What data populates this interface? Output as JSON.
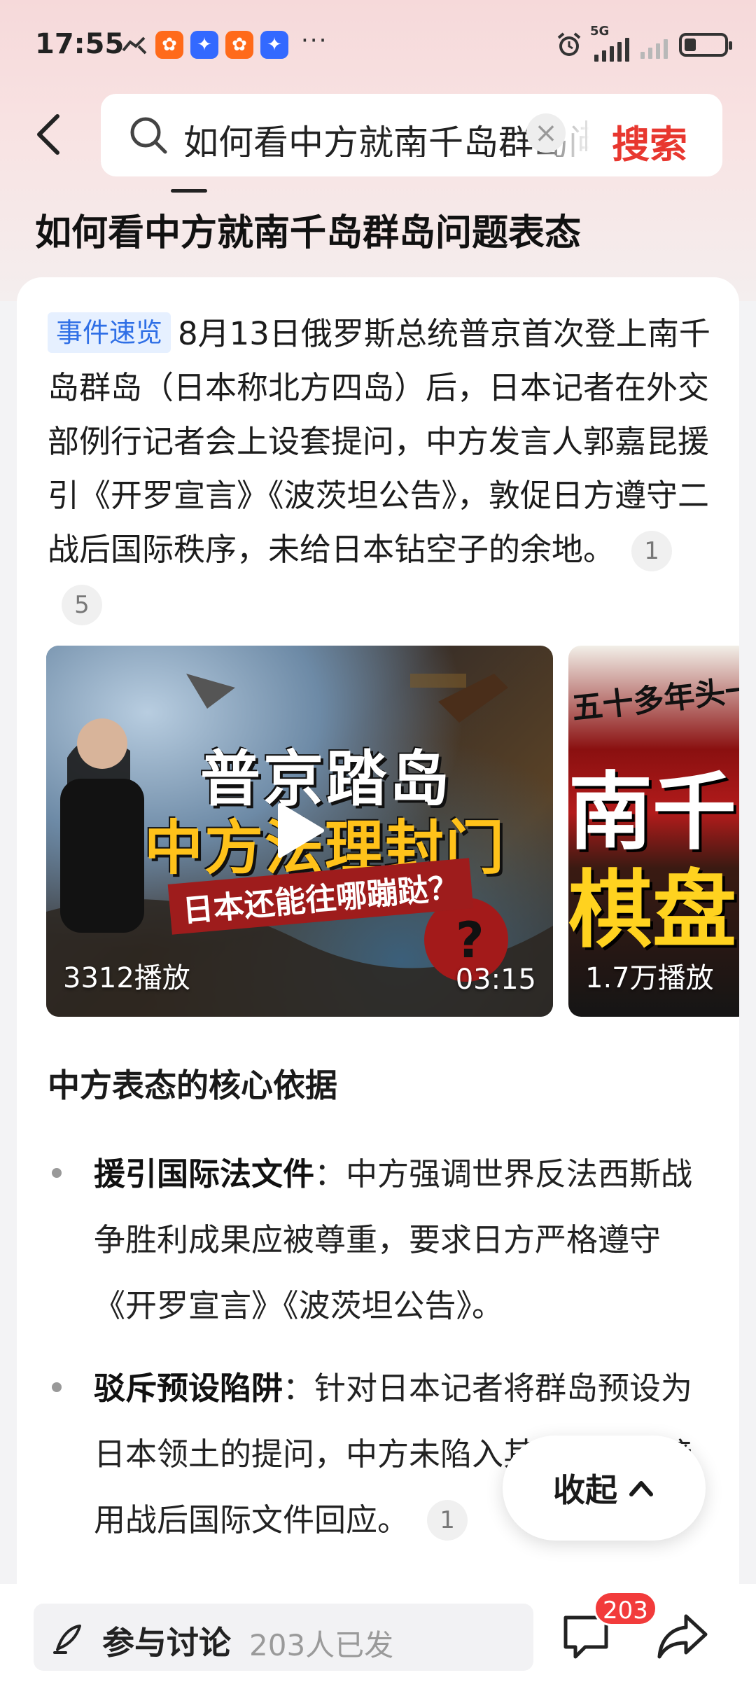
{
  "status_bar": {
    "time": "17:55",
    "app_icons": [
      "app-icon-orange",
      "app-icon-blue",
      "app-icon-orange",
      "app-icon-blue"
    ],
    "more": "···",
    "network": "5G",
    "battery_level": 0.3
  },
  "search": {
    "query": "如何看中方就南千岛群岛问题表态",
    "clear": "×",
    "button": "搜索"
  },
  "page": {
    "title": "如何看中方就南千岛群岛问题表态"
  },
  "summary": {
    "tag": "事件速览",
    "text": "8月13日俄罗斯总统普京首次登上南千岛群岛（日本称北方四岛）后，日本记者在外交部例行记者会上设套提问，中方发言人郭嘉昆援引《开罗宣言》《波茨坦公告》，敦促日方遵守二战后国际秩序，未给日本钻空子的余地。",
    "citations": [
      "1",
      "5"
    ]
  },
  "videos": [
    {
      "title_line1": "普京踏岛",
      "title_line2": "中方法理封门",
      "subtitle": "日本还能往哪蹦跶？",
      "plays": "3312播放",
      "duration": "03:15"
    },
    {
      "top_text": "五十多年头一",
      "big_line1": "南千",
      "big_line2": "棋盘",
      "plays": "1.7万播放"
    }
  ],
  "section": {
    "heading": "中方表态的核心依据",
    "bullets": [
      {
        "label": "援引国际法文件",
        "text": "：中方强调世界反法西斯战争胜利成果应被尊重，要求日方严格遵守《开罗宣言》《波茨坦公告》。"
      },
      {
        "label": "驳斥预设陷阱",
        "text": "：针对日本记者将群岛预设为日本领土的提问，中方未陷入其逻辑，直接用战后国际文件回应。",
        "citation": "1"
      }
    ]
  },
  "collapse": {
    "label": "收起"
  },
  "bottom_bar": {
    "comment_label": "参与讨论",
    "comment_count": "203人已发",
    "badge": "203"
  },
  "colors": {
    "accent_red": "#e8372f",
    "tag_blue": "#2f6fe6",
    "badge_red": "#f23b3b"
  }
}
